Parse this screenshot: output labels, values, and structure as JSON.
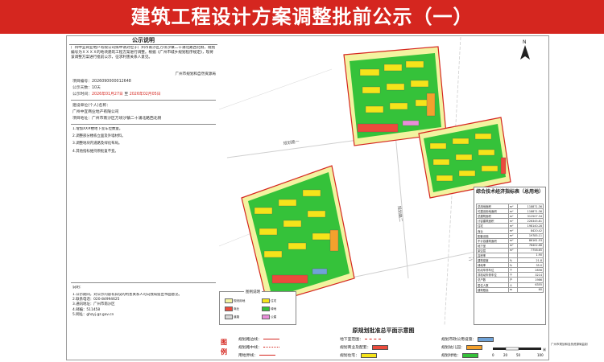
{
  "banner": {
    "title": "建筑工程设计方案调整批前公示（一）"
  },
  "left": {
    "heading": "公示说明",
    "intro": "广州中宜商业地产有限公司拟申请对位于广州市南沙区万顷沙镇二十涌北路西北侧，规划编号为ＸＸＸＸ的地块建筑工程方案进行调整。根据《广州市城乡规划程序规定》，现将该调整方案进行批前公示，征求利害关系人意见。",
    "sign": "广州市规划和自然资源局",
    "project_no_label": "项目编号：",
    "project_no": "2026090000012648",
    "period_label": "公示天数：",
    "period": "10天",
    "dates_label": "公示时间：",
    "date_start": "2026年01月27日",
    "date_to": "至",
    "date_end": "2026年02月05日",
    "applicant_label": "建设单位(个人)名称：",
    "applicant": "广州中宜商业地产有限公司",
    "address_label": "项目地址：",
    "address": "广州市南沙区万顷沙镇二十涌北路西北侧",
    "adjust_items": [
      "1.增加XX#楼地下室车位数量。",
      "2.调整部分楼栋立面及外墙材料。",
      "3.调整地块内道路及绿化布局。",
      "4.其他指标维持原批复不变。"
    ],
    "notes_heading": "说明：",
    "notes": [
      "1.公示期间，对公示内容有异议的利害关系人可向我局提出书面意见。",
      "2.联系电话：020-84994625",
      "3.通讯地址：广州市南沙区",
      "4.邮编：511458",
      "5.网址：ghzyj.gz.gov.cn"
    ]
  },
  "plan": {
    "road_labels": [
      "规划路一",
      "规划路二",
      "二十涌北路"
    ],
    "compass_label": "N"
  },
  "indicator": {
    "title": "综合技术经济指标表（总用地）",
    "rows": [
      [
        "总用地面积",
        "m²",
        "118871.36"
      ],
      [
        "可建设用地面积",
        "m²",
        "118871.36"
      ],
      [
        "总建筑面积",
        "m²",
        "312507.34"
      ],
      [
        "计容建筑面积",
        "m²",
        "226345.81"
      ],
      [
        "住宅",
        "m²",
        "198140.28"
      ],
      [
        "商业",
        "m²",
        "8420.42"
      ],
      [
        "配套设施",
        "m²",
        "19785.11"
      ],
      [
        "不计容建筑面积",
        "m²",
        "86161.53"
      ],
      [
        "地下室",
        "m²",
        "78402.88"
      ],
      [
        "架空层",
        "m²",
        "7758.65"
      ],
      [
        "容积率",
        "",
        "1.90"
      ],
      [
        "建筑密度",
        "%",
        "21.8"
      ],
      [
        "绿地率",
        "%",
        "35.0"
      ],
      [
        "机动车停车位",
        "个",
        "2856"
      ],
      [
        "非机动车停车位",
        "个",
        "3214"
      ],
      [
        "总户数",
        "户",
        "1986"
      ],
      [
        "居住人数",
        "人",
        "6355"
      ],
      [
        "建筑限高",
        "m",
        "60"
      ]
    ]
  },
  "legend": {
    "title": "图例说明",
    "items": [
      {
        "label": "规划用地",
        "color": "#f3f3a0"
      },
      {
        "label": "住宅",
        "color": "#f5e41a"
      },
      {
        "label": "商业",
        "color": "#ec4b3c"
      },
      {
        "label": "绿地",
        "color": "#35c23a"
      },
      {
        "label": "道路",
        "color": "#d7d7d7"
      },
      {
        "label": "公建",
        "color": "#e88ed9"
      }
    ]
  },
  "bottom": {
    "title": "原规划批准总平面示意图",
    "legend_label": "图例",
    "items": [
      {
        "label": "规划路边线：",
        "kind": "line",
        "color": "#d5261f"
      },
      {
        "label": "地下室范围：",
        "kind": "dash",
        "color": "#d5261f"
      },
      {
        "label": "规划市政公用设施：",
        "kind": "fill",
        "color": "#6fa3d9"
      },
      {
        "label": "规划路中线：",
        "kind": "dashdot",
        "color": "#d5261f"
      },
      {
        "label": "规划商业及配套：",
        "kind": "fill",
        "color": "#ec4b3c"
      },
      {
        "label": "规划幼儿园：",
        "kind": "fill",
        "color": "#f4a12d"
      },
      {
        "label": "用地界线：",
        "kind": "line",
        "color": "#d5261f"
      },
      {
        "label": "规划住宅：",
        "kind": "fill",
        "color": "#f5e41a"
      },
      {
        "label": "规划绿地：",
        "kind": "fill",
        "color": "#35c23a"
      }
    ]
  },
  "scale": {
    "labels": [
      "0",
      "20",
      "50",
      "100"
    ],
    "unit": "米"
  },
  "corner_note": "广州市规划和自然资源局监制"
}
